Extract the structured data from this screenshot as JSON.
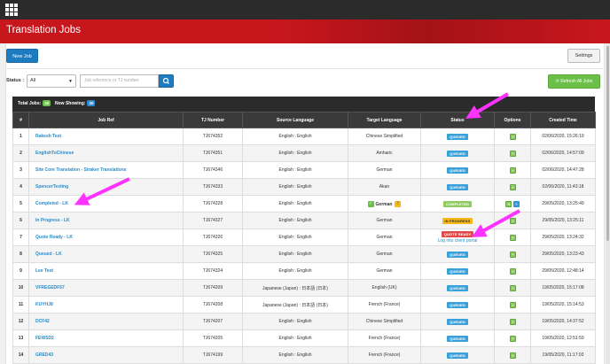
{
  "header": {
    "title": "Translation Jobs"
  },
  "toolbar": {
    "new_job": "New Job",
    "settings": "Settings"
  },
  "filters": {
    "status_label": "Status :",
    "status_value": "All",
    "search_placeholder": "Job reference or TJ number",
    "refresh": "Refresh All Jobs"
  },
  "summary": {
    "total_label": "Total Jobs:",
    "total_count": "30",
    "showing_label": "Now Showing:",
    "showing_count": "30"
  },
  "columns": [
    "#",
    "Job Ref",
    "TJ Number",
    "Source Language",
    "Target Language",
    "Status",
    "Options",
    "Created Time"
  ],
  "rows": [
    {
      "num": "1",
      "ref": "Rakesh Test",
      "tj": "TJ674352",
      "source": "English : English",
      "target": "Chinese Simplified",
      "status": "QUEUED",
      "status_kind": "queued",
      "created": "02/06/2020, 15:26:19"
    },
    {
      "num": "2",
      "ref": "EnglishToChinese",
      "tj": "TJ674351",
      "source": "English : English",
      "target": "Amharic",
      "status": "QUEUED",
      "status_kind": "queued",
      "created": "02/06/2020, 14:57:09"
    },
    {
      "num": "3",
      "ref": "Site Core Translation - Straker Translations",
      "tj": "TJ674346",
      "source": "English : English",
      "target": "German",
      "status": "QUEUED",
      "status_kind": "queued",
      "created": "02/06/2020, 14:47:28"
    },
    {
      "num": "4",
      "ref": "SpencerTexting",
      "tj": "TJ674333",
      "source": "English : English",
      "target": "Akan",
      "status": "QUEUED",
      "status_kind": "queued",
      "created": "02/06/2020, 11:43:18"
    },
    {
      "num": "5",
      "ref": "Completed - LK",
      "tj": "TJ674328",
      "source": "English : English",
      "target": "German",
      "status": "COMPLETED",
      "status_kind": "completed",
      "created": "29/05/2020, 13:25:49"
    },
    {
      "num": "6",
      "ref": "In Progress - LK",
      "tj": "TJ674327",
      "source": "English : English",
      "target": "German",
      "status": "IN PROGRESS",
      "status_kind": "inprogress",
      "created": "29/05/2020, 13:25:11"
    },
    {
      "num": "7",
      "ref": "Quote Ready - LK",
      "tj": "TJ674326",
      "source": "English : English",
      "target": "German",
      "status": "QUOTE READY",
      "status_kind": "quote",
      "portal_link": "Log into client portal",
      "created": "29/05/2020, 13:24:32"
    },
    {
      "num": "8",
      "ref": "Queued - LK",
      "tj": "TJ674325",
      "source": "English : English",
      "target": "German",
      "status": "QUEUED",
      "status_kind": "queued",
      "created": "29/05/2020, 13:23:43"
    },
    {
      "num": "9",
      "ref": "Lee Test",
      "tj": "TJ674324",
      "source": "English : English",
      "target": "German",
      "status": "QUEUED",
      "status_kind": "queued",
      "created": "29/05/2020, 12:48:14"
    },
    {
      "num": "10",
      "ref": "VFREGEDF67",
      "tj": "TJ674209",
      "source": "Japanese (Japan) : 日本語 (日本)",
      "target": "English (UK)",
      "status": "QUEUED",
      "status_kind": "queued",
      "created": "19/05/2020, 15:17:08"
    },
    {
      "num": "11",
      "ref": "KUYHJ8",
      "tj": "TJ674208",
      "source": "Japanese (Japan) : 日本語 (日本)",
      "target": "French (France)",
      "status": "QUEUED",
      "status_kind": "queued",
      "created": "19/05/2020, 15:14:53"
    },
    {
      "num": "12",
      "ref": "DCF42",
      "tj": "TJ674207",
      "source": "English : English",
      "target": "Chinese Simplified",
      "status": "QUEUED",
      "status_kind": "queued",
      "created": "19/05/2020, 14:37:52"
    },
    {
      "num": "13",
      "ref": "FEWSD2",
      "tj": "TJ674205",
      "source": "English : English",
      "target": "French (France)",
      "status": "QUEUED",
      "status_kind": "queued",
      "created": "19/05/2020, 12:51:59"
    },
    {
      "num": "14",
      "ref": "GRED43",
      "tj": "TJ674199",
      "source": "English : English",
      "target": "French (France)",
      "status": "QUEUED",
      "status_kind": "queued",
      "created": "19/05/2020, 11:17:03"
    }
  ],
  "colors": {
    "brand_red": "#c8161d",
    "primary_blue": "#1e7bbf",
    "accent_green": "#6cc04a",
    "link_blue": "#2a8bc9",
    "annotation_magenta": "#ff33ff"
  }
}
